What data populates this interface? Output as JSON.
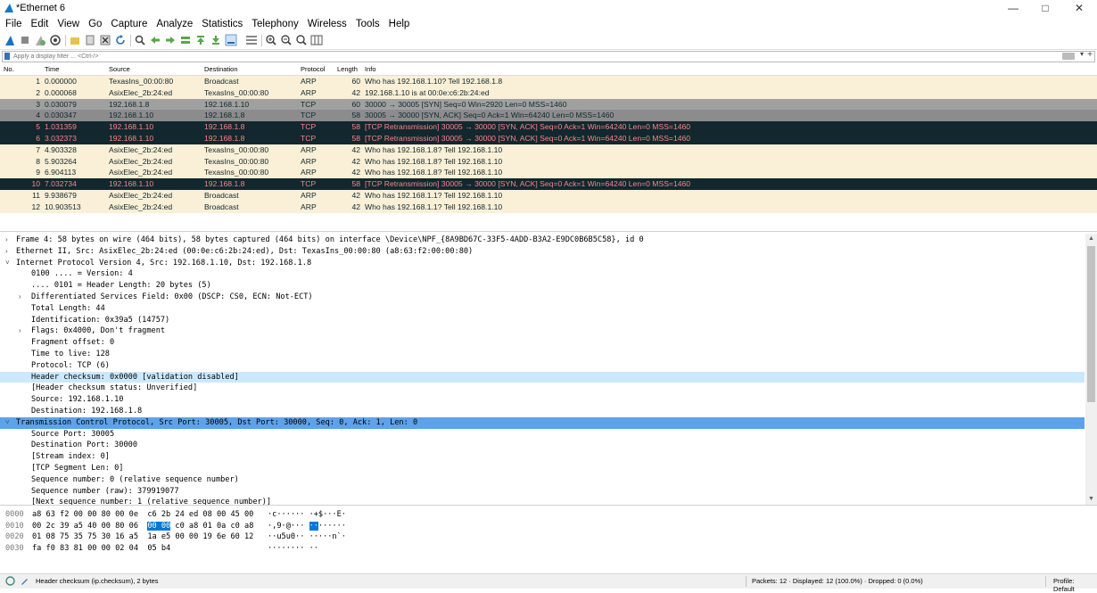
{
  "window": {
    "title": "*Ethernet 6"
  },
  "menu": [
    "File",
    "Edit",
    "View",
    "Go",
    "Capture",
    "Analyze",
    "Statistics",
    "Telephony",
    "Wireless",
    "Tools",
    "Help"
  ],
  "filter": {
    "placeholder": "Apply a display filter ... <Ctrl-/>"
  },
  "columns": {
    "no": "No.",
    "time": "Time",
    "source": "Source",
    "destination": "Destination",
    "protocol": "Protocol",
    "length": "Length",
    "info": "Info"
  },
  "packets": [
    {
      "no": "1",
      "time": "0.000000",
      "src": "TexasIns_00:00:80",
      "dst": "Broadcast",
      "proto": "ARP",
      "len": "60",
      "info": "Who has 192.168.1.10? Tell 192.168.1.8",
      "style": "arp"
    },
    {
      "no": "2",
      "time": "0.000068",
      "src": "AsixElec_2b:24:ed",
      "dst": "TexasIns_00:00:80",
      "proto": "ARP",
      "len": "42",
      "info": "192.168.1.10 is at 00:0e:c6:2b:24:ed",
      "style": "arp"
    },
    {
      "no": "3",
      "time": "0.030079",
      "src": "192.168.1.8",
      "dst": "192.168.1.10",
      "proto": "TCP",
      "len": "60",
      "info": "30000 → 30005 [SYN] Seq=0 Win=2920 Len=0 MSS=1460",
      "style": "tcp"
    },
    {
      "no": "4",
      "time": "0.030347",
      "src": "192.168.1.10",
      "dst": "192.168.1.8",
      "proto": "TCP",
      "len": "58",
      "info": "30005 → 30000 [SYN, ACK] Seq=0 Ack=1 Win=64240 Len=0 MSS=1460",
      "style": "tcpsel"
    },
    {
      "no": "5",
      "time": "1.031359",
      "src": "192.168.1.10",
      "dst": "192.168.1.8",
      "proto": "TCP",
      "len": "58",
      "info": "[TCP Retransmission] 30005 → 30000 [SYN, ACK] Seq=0 Ack=1 Win=64240 Len=0 MSS=1460",
      "style": "bad"
    },
    {
      "no": "6",
      "time": "3.032373",
      "src": "192.168.1.10",
      "dst": "192.168.1.8",
      "proto": "TCP",
      "len": "58",
      "info": "[TCP Retransmission] 30005 → 30000 [SYN, ACK] Seq=0 Ack=1 Win=64240 Len=0 MSS=1460",
      "style": "bad"
    },
    {
      "no": "7",
      "time": "4.903328",
      "src": "AsixElec_2b:24:ed",
      "dst": "TexasIns_00:00:80",
      "proto": "ARP",
      "len": "42",
      "info": "Who has 192.168.1.8? Tell 192.168.1.10",
      "style": "arp"
    },
    {
      "no": "8",
      "time": "5.903264",
      "src": "AsixElec_2b:24:ed",
      "dst": "TexasIns_00:00:80",
      "proto": "ARP",
      "len": "42",
      "info": "Who has 192.168.1.8? Tell 192.168.1.10",
      "style": "arp"
    },
    {
      "no": "9",
      "time": "6.904113",
      "src": "AsixElec_2b:24:ed",
      "dst": "TexasIns_00:00:80",
      "proto": "ARP",
      "len": "42",
      "info": "Who has 192.168.1.8? Tell 192.168.1.10",
      "style": "arp"
    },
    {
      "no": "10",
      "time": "7.032734",
      "src": "192.168.1.10",
      "dst": "192.168.1.8",
      "proto": "TCP",
      "len": "58",
      "info": "[TCP Retransmission] 30005 → 30000 [SYN, ACK] Seq=0 Ack=1 Win=64240 Len=0 MSS=1460",
      "style": "bad"
    },
    {
      "no": "11",
      "time": "9.938679",
      "src": "AsixElec_2b:24:ed",
      "dst": "Broadcast",
      "proto": "ARP",
      "len": "42",
      "info": "Who has 192.168.1.1? Tell 192.168.1.10",
      "style": "arp"
    },
    {
      "no": "12",
      "time": "10.903513",
      "src": "AsixElec_2b:24:ed",
      "dst": "Broadcast",
      "proto": "ARP",
      "len": "42",
      "info": "Who has 192.168.1.1? Tell 192.168.1.10",
      "style": "arp"
    }
  ],
  "details": [
    {
      "text": "Frame 4: 58 bytes on wire (464 bits), 58 bytes captured (464 bits) on interface \\Device\\NPF_{8A9BD67C-33F5-4ADD-B3A2-E9DC0B6B5C58}, id 0",
      "indent": 0,
      "arrow": "collapsed"
    },
    {
      "text": "Ethernet II, Src: AsixElec_2b:24:ed (00:0e:c6:2b:24:ed), Dst: TexasIns_00:00:80 (a8:63:f2:00:00:80)",
      "indent": 0,
      "arrow": "collapsed"
    },
    {
      "text": "Internet Protocol Version 4, Src: 192.168.1.10, Dst: 192.168.1.8",
      "indent": 0,
      "arrow": "expanded"
    },
    {
      "text": "0100 .... = Version: 4",
      "indent": 1,
      "arrow": ""
    },
    {
      "text": ".... 0101 = Header Length: 20 bytes (5)",
      "indent": 1,
      "arrow": ""
    },
    {
      "text": "Differentiated Services Field: 0x00 (DSCP: CS0, ECN: Not-ECT)",
      "indent": 1,
      "arrow": "collapsed"
    },
    {
      "text": "Total Length: 44",
      "indent": 1,
      "arrow": ""
    },
    {
      "text": "Identification: 0x39a5 (14757)",
      "indent": 1,
      "arrow": ""
    },
    {
      "text": "Flags: 0x4000, Don't fragment",
      "indent": 1,
      "arrow": "collapsed"
    },
    {
      "text": "Fragment offset: 0",
      "indent": 1,
      "arrow": ""
    },
    {
      "text": "Time to live: 128",
      "indent": 1,
      "arrow": ""
    },
    {
      "text": "Protocol: TCP (6)",
      "indent": 1,
      "arrow": ""
    },
    {
      "text": "Header checksum: 0x0000 [validation disabled]",
      "indent": 1,
      "arrow": "",
      "hl": "hover"
    },
    {
      "text": "[Header checksum status: Unverified]",
      "indent": 1,
      "arrow": ""
    },
    {
      "text": "Source: 192.168.1.10",
      "indent": 1,
      "arrow": ""
    },
    {
      "text": "Destination: 192.168.1.8",
      "indent": 1,
      "arrow": ""
    },
    {
      "text": "Transmission Control Protocol, Src Port: 30005, Dst Port: 30000, Seq: 0, Ack: 1, Len: 0",
      "indent": 0,
      "arrow": "expanded",
      "hl": "selected"
    },
    {
      "text": "Source Port: 30005",
      "indent": 1,
      "arrow": ""
    },
    {
      "text": "Destination Port: 30000",
      "indent": 1,
      "arrow": ""
    },
    {
      "text": "[Stream index: 0]",
      "indent": 1,
      "arrow": ""
    },
    {
      "text": "[TCP Segment Len: 0]",
      "indent": 1,
      "arrow": ""
    },
    {
      "text": "Sequence number: 0    (relative sequence number)",
      "indent": 1,
      "arrow": ""
    },
    {
      "text": "Sequence number (raw): 379919077",
      "indent": 1,
      "arrow": ""
    },
    {
      "text": "[Next sequence number: 1    (relative sequence number)]",
      "indent": 1,
      "arrow": ""
    }
  ],
  "bytes": [
    {
      "off": "0000",
      "hex_pre": "a8 63 f2 00 00 80 00 0e  c6 2b 24 ed 08 00 45 00",
      "hex_hl": "",
      "hex_post": "",
      "asc_pre": "·c······ ·+$···E·",
      "asc_hl": "",
      "asc_post": ""
    },
    {
      "off": "0010",
      "hex_pre": "00 2c 39 a5 40 00 80 06  ",
      "hex_hl": "00 00",
      "hex_post": " c0 a8 01 0a c0 a8",
      "asc_pre": "·,9·@··· ",
      "asc_hl": "··",
      "asc_post": "······"
    },
    {
      "off": "0020",
      "hex_pre": "01 08 75 35 75 30 16 a5  1a e5 00 00 19 6e 60 12",
      "hex_hl": "",
      "hex_post": "",
      "asc_pre": "··u5u0·· ·····n`·",
      "asc_hl": "",
      "asc_post": ""
    },
    {
      "off": "0030",
      "hex_pre": "fa f0 83 81 00 00 02 04  05 b4",
      "hex_hl": "",
      "hex_post": "",
      "asc_pre": "········ ··",
      "asc_hl": "",
      "asc_post": ""
    }
  ],
  "status": {
    "field": "Header checksum (ip.checksum), 2 bytes",
    "packets": "Packets: 12 · Displayed: 12 (100.0%) · Dropped: 0 (0.0%)",
    "profile": "Profile: Default"
  },
  "colors": {
    "arp": "#faf0d7",
    "tcp": "#a0a0a0",
    "bad_bg": "#12272e",
    "bad_fg": "#f78787",
    "selected": "#5ea2ec",
    "hover": "#cce8ff"
  }
}
